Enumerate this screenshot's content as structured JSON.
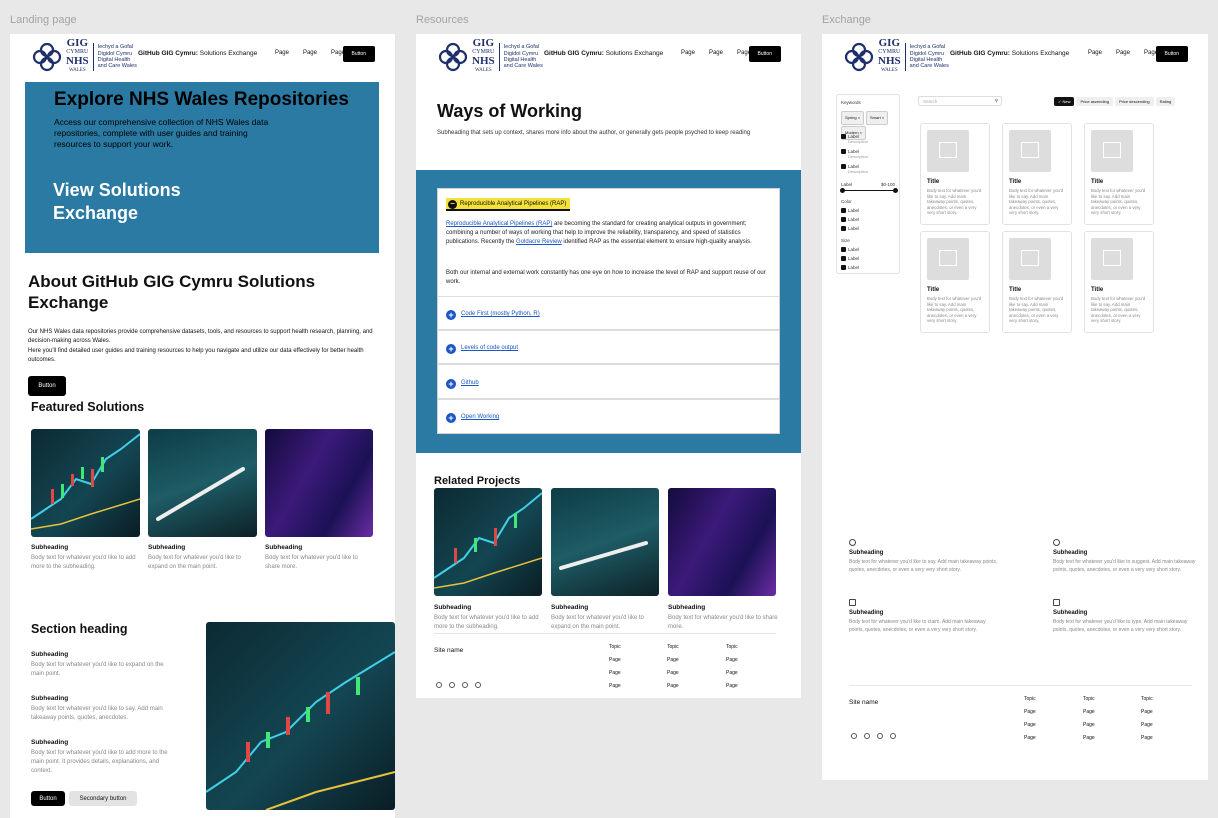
{
  "frames": {
    "landing": "Landing page",
    "resources": "Resources",
    "exchange": "Exchange"
  },
  "nav": {
    "logo_gig": "GIG",
    "logo_cymru": "CYMRU",
    "logo_nhs": "NHS",
    "logo_wales": "WALES",
    "logo_lines": [
      "Iechyd a Gofal",
      "Digidol Cymru",
      "Digital Health",
      "and Care Wales"
    ],
    "brand_bold": "GitHub GIG Cymru:",
    "brand_rest": " Solutions Exchange",
    "links": [
      "Page",
      "Page",
      "Page"
    ],
    "button": "Button"
  },
  "landing": {
    "hero_title": "Explore NHS Wales Repositories",
    "hero_text": "Access our comprehensive collection of NHS Wales data repositories, complete with user guides and training resources to support your work.",
    "hero_link": "View Solutions Exchange",
    "about_title": "About GitHub GIG Cymru Solutions Exchange",
    "about_text_1": "Our NHS Wales data repositories provide comprehensive datasets, tools, and resources to support health research, planning, and decision-making across Wales.",
    "about_text_2": "Here you'll find detailed user guides and training resources to help you navigate and utilize our data effectively for better health outcomes.",
    "about_button": "Button",
    "featured_title": "Featured Solutions",
    "featured": [
      {
        "sub": "Subheading",
        "text": "Body text for whatever you'd like to add more to the subheading."
      },
      {
        "sub": "Subheading",
        "text": "Body text for whatever you'd like to expand on the main point."
      },
      {
        "sub": "Subheading",
        "text": "Body text for whatever you'd like to share more."
      }
    ],
    "section_title": "Section heading",
    "section_items": [
      {
        "sub": "Subheading",
        "text": "Body text for whatever you'd like to expand on the main point."
      },
      {
        "sub": "Subheading",
        "text": "Body text for whatever you'd like to say. Add main takeaway points, quotes, anecdotes."
      },
      {
        "sub": "Subheading",
        "text": "Body text for whatever you'd like to add more to the main point. It provides details, explanations, and context."
      }
    ],
    "btn_primary": "Button",
    "btn_secondary": "Secondary button"
  },
  "resources": {
    "title": "Ways of Working",
    "subtitle": "Subheading that sets up context, shares more info about the author, or generally gets people psyched to keep reading",
    "open_item": "Reproducible Analytical Pipelines (RAP)",
    "open_p1_link": "Reproducible Analytical Pipelines (RAP)",
    "open_p1_a": " are becoming the standard for creating analytical outputs in government; combining a number of ways of working that help to improve the reliability, transparency, and speed of statistics publications. Recently the ",
    "open_p1_link2": "Goldacre Review",
    "open_p1_b": " identified RAP as the essential element to ensure high-quality analysis.",
    "open_p2": "Both our internal and external work constantly has one eye on how to increase the level of RAP and support reuse of our work.",
    "items": [
      "Code First (mostly Python, R)",
      "Levels of code output",
      "Github",
      "Open Working"
    ],
    "related_title": "Related Projects",
    "related": [
      {
        "sub": "Subheading",
        "text": "Body text for whatever you'd like to add more to the subheading."
      },
      {
        "sub": "Subheading",
        "text": "Body text for whatever you'd like to expand on the main point."
      },
      {
        "sub": "Subheading",
        "text": "Body text for whatever you'd like to share more."
      }
    ]
  },
  "footer": {
    "site_name": "Site name",
    "cols": [
      [
        "Topic",
        "Page",
        "Page",
        "Page"
      ],
      [
        "Topic",
        "Page",
        "Page",
        "Page"
      ],
      [
        "Topic",
        "Page",
        "Page",
        "Page"
      ]
    ]
  },
  "exchange": {
    "search_placeholder": "Search",
    "sorts": [
      "New",
      "Price ascending",
      "Price descending",
      "Rating"
    ],
    "keywords_label": "Keywords",
    "chips": [
      "Spring",
      "Smart",
      "Modern"
    ],
    "checks": [
      {
        "label": "Label",
        "desc": "Description"
      },
      {
        "label": "Label",
        "desc": "Description"
      },
      {
        "label": "Label",
        "desc": "Description"
      }
    ],
    "range_label": "Label",
    "range_value": "$0-100",
    "color_label": "Color",
    "color_items": [
      "Label",
      "Label",
      "Label"
    ],
    "size_label": "Size",
    "size_items": [
      "Label",
      "Label",
      "Label"
    ],
    "cards": [
      {
        "title": "Title",
        "text": "Body text for whatever you'd like to say. Add main takeaway points, quotes, anecdotes, or even a very very short story."
      },
      {
        "title": "Title",
        "text": "Body text for whatever you'd like to say. Add main takeaway points, quotes, anecdotes, or even a very very short story."
      },
      {
        "title": "Title",
        "text": "Body text for whatever you'd like to say. Add main takeaway points, quotes, anecdotes, or even a very very short story."
      },
      {
        "title": "Title",
        "text": "Body text for whatever you'd like to say. Add main takeaway points, quotes, anecdotes, or even a very very short story."
      },
      {
        "title": "Title",
        "text": "Body text for whatever you'd like to say. Add main takeaway points, quotes, anecdotes, or even a very very short story."
      },
      {
        "title": "Title",
        "text": "Body text for whatever you'd like to say. Add main takeaway points, quotes, anecdotes, or even a very very short story."
      }
    ],
    "features": [
      {
        "icon": "globe-icon",
        "sub": "Subheading",
        "text": "Body text for whatever you'd like to say. Add main takeaway points, quotes, anecdotes, or even a very very short story."
      },
      {
        "icon": "user-icon",
        "sub": "Subheading",
        "text": "Body text for whatever you'd like to suggest. Add main takeaway points, quotes, anecdotes, or even a very very short story."
      },
      {
        "icon": "lock-icon",
        "sub": "Subheading",
        "text": "Body text for whatever you'd like to claim. Add main takeaway points, quotes, anecdotes, or even a very very short story."
      },
      {
        "icon": "calendar-icon",
        "sub": "Subheading",
        "text": "Body text for whatever you'd like to type. Add main takeaway points, quotes, anecdotes, or even a very very short story."
      }
    ]
  }
}
